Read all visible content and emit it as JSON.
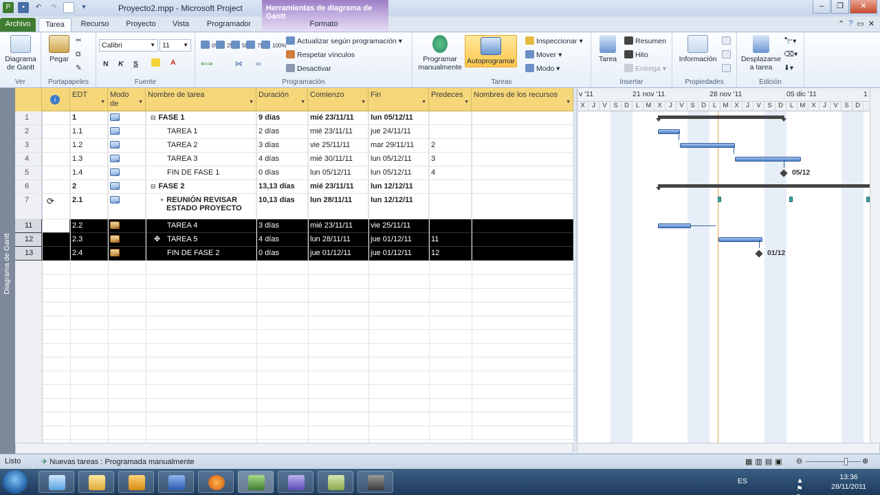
{
  "window": {
    "title": "Proyecto2.mpp - Microsoft Project",
    "contextual_tab_group": "Herramientas de diagrama de Gantt"
  },
  "tabs": [
    "Archivo",
    "Tarea",
    "Recurso",
    "Proyecto",
    "Vista",
    "Programador",
    "Formato"
  ],
  "ribbon": {
    "ver": {
      "btn": "Diagrama de Gantt",
      "label": "Ver"
    },
    "portapapeles": {
      "pegar": "Pegar",
      "label": "Portapapeles"
    },
    "fuente": {
      "font": "Calibri",
      "size": "11",
      "bold": "N",
      "italic": "K",
      "underline": "S",
      "label": "Fuente"
    },
    "programacion": {
      "percents": [
        "0%",
        "25%",
        "50%",
        "75%",
        "100%"
      ],
      "actualizar": "Actualizar según programación",
      "respetar": "Respetar vínculos",
      "desactivar": "Desactivar",
      "label": "Programación"
    },
    "tareas": {
      "programar": "Programar manualmente",
      "auto": "Autoprogramar",
      "inspeccionar": "Inspeccionar",
      "mover": "Mover",
      "modo": "Modo",
      "label": "Tareas"
    },
    "insertar": {
      "tarea": "Tarea",
      "resumen": "Resumen",
      "hito": "Hito",
      "entrega": "Entrega",
      "label": "Insertar"
    },
    "propiedades": {
      "informacion": "Información",
      "label": "Propiedades"
    },
    "edicion": {
      "desplazarse": "Desplazarse a tarea",
      "label": "Edición"
    }
  },
  "sidebar_label": "Diagrama de Gantt",
  "grid": {
    "headers": {
      "edt": "EDT",
      "modo": "Modo de",
      "nombre": "Nombre de tarea",
      "duracion": "Duración",
      "comienzo": "Comienzo",
      "fin": "Fin",
      "predecesoras": "Predeces",
      "recursos": "Nombres de los recursos"
    },
    "rows": [
      {
        "id": "1",
        "edt": "1",
        "name": "FASE 1",
        "dur": "9 días",
        "start": "mié 23/11/11",
        "end": "lun 05/12/11",
        "pred": "",
        "summary": true
      },
      {
        "id": "2",
        "edt": "1.1",
        "name": "TAREA 1",
        "dur": "2 días",
        "start": "mié 23/11/11",
        "end": "jue 24/11/11",
        "pred": ""
      },
      {
        "id": "3",
        "edt": "1.2",
        "name": "TAREA 2",
        "dur": "3 días",
        "start": "vie 25/11/11",
        "end": "mar 29/11/11",
        "pred": "2"
      },
      {
        "id": "4",
        "edt": "1.3",
        "name": "TAREA 3",
        "dur": "4 días",
        "start": "mié 30/11/11",
        "end": "lun 05/12/11",
        "pred": "3"
      },
      {
        "id": "5",
        "edt": "1.4",
        "name": "FIN DE FASE 1",
        "dur": "0 días",
        "start": "lun 05/12/11",
        "end": "lun 05/12/11",
        "pred": "4"
      },
      {
        "id": "6",
        "edt": "2",
        "name": "FASE 2",
        "dur": "13,13 días",
        "start": "mié 23/11/11",
        "end": "lun 12/12/11",
        "pred": "",
        "summary": true
      },
      {
        "id": "7",
        "edt": "2.1",
        "name": "REUNIÓN REVISAR",
        "name2": "ESTADO PROYECTO",
        "dur": "10,13 días",
        "start": "lun 28/11/11",
        "end": "lun 12/12/11",
        "pred": "",
        "summary": true
      },
      {
        "id": "11",
        "edt": "2.2",
        "name": "TAREA 4",
        "dur": "3 días",
        "start": "mié 23/11/11",
        "end": "vie 25/11/11",
        "pred": ""
      },
      {
        "id": "12",
        "edt": "2.3",
        "name": "TAREA 5",
        "dur": "4 días",
        "start": "lun 28/11/11",
        "end": "jue 01/12/11",
        "pred": "11"
      },
      {
        "id": "13",
        "edt": "2.4",
        "name": "FIN DE FASE 2",
        "dur": "0 días",
        "start": "jue 01/12/11",
        "end": "jue 01/12/11",
        "pred": "12"
      }
    ]
  },
  "gantt": {
    "weeks": [
      "v '11",
      "21 nov '11",
      "28 nov '11",
      "05 dic '11",
      "1"
    ],
    "days": [
      "X",
      "J",
      "V",
      "S",
      "D",
      "L",
      "M",
      "X",
      "J",
      "V",
      "S",
      "D",
      "L",
      "M",
      "X",
      "J",
      "V",
      "S",
      "D",
      "L",
      "M",
      "X",
      "J",
      "V",
      "S",
      "D"
    ],
    "milestone_labels": [
      "05/12",
      "01/12"
    ]
  },
  "status": {
    "ready": "Listo",
    "new_tasks": "Nuevas tareas : Programada manualmente"
  },
  "taskbar": {
    "lang": "ES",
    "time": "13:36",
    "date": "28/11/2011"
  },
  "colors": {
    "accent": "#f5d77a",
    "bar": "#4a7bc3",
    "today": "#e1a84c",
    "archivo": "#3e7c2f"
  }
}
